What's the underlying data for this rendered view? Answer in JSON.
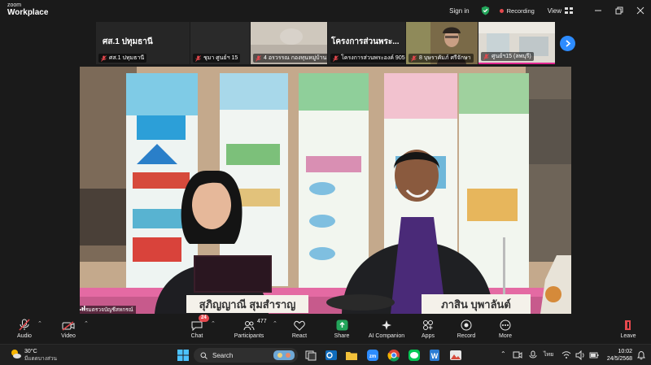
{
  "app": {
    "brand_top": "zoom",
    "brand_bottom": "Workplace",
    "sign_in": "Sign in",
    "recording": "Recording",
    "view": "View"
  },
  "thumbnails": [
    {
      "title": "ศส.1 ปทุมธานี",
      "caption": "ศส.1 ปทุมธานี"
    },
    {
      "title": "",
      "caption": "ชุมา ศูนย์ฯ 15"
    },
    {
      "title": "",
      "caption": "4  อรวรรณ กองทุนหมู่บ้าน"
    },
    {
      "title": "โครงการส่วนพระ...",
      "caption": "โครงการส่วนพระองค์ 905..."
    },
    {
      "title": "",
      "caption": "8 บุษราคัมภ์ ศรีจักษา"
    },
    {
      "title": "",
      "caption": "ศูนย์ฯ15 (ลพบุรี)"
    }
  ],
  "video": {
    "speaker_tag": "กรมตรวจบัญชีสหกรณ์",
    "nameplate_left": "สุภิญญาณี สุมสำราญ",
    "nameplate_right": "ภาสิน  บุพาลันต์"
  },
  "toolbar": {
    "audio": "Audio",
    "video": "Video",
    "chat": "Chat",
    "chat_badge": "24",
    "participants": "Participants",
    "participants_count": "477",
    "react": "React",
    "share": "Share",
    "ai_companion": "AI Companion",
    "apps": "Apps",
    "record": "Record",
    "more": "More",
    "leave": "Leave"
  },
  "taskbar": {
    "temperature": "30°C",
    "weather_desc": "มีแดดบางส่วน",
    "search": "Search",
    "lang": "ไทย",
    "time": "10:02",
    "date": "24/5/2568"
  },
  "colors": {
    "accent": "#2d8cff",
    "recording": "#e5484d",
    "share": "#23a55a"
  }
}
